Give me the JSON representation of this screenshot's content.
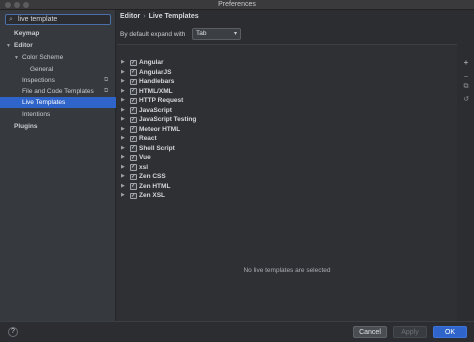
{
  "window": {
    "title": "Preferences"
  },
  "sidebar": {
    "search_value": "live template",
    "items": [
      {
        "label": "Keymap"
      },
      {
        "label": "Editor"
      },
      {
        "label": "Color Scheme"
      },
      {
        "label": "General"
      },
      {
        "label": "Inspections"
      },
      {
        "label": "File and Code Templates"
      },
      {
        "label": "Live Templates"
      },
      {
        "label": "Intentions"
      },
      {
        "label": "Plugins"
      }
    ]
  },
  "main": {
    "breadcrumb": {
      "parent": "Editor",
      "separator": "›",
      "current": "Live Templates"
    },
    "expand_label": "By default expand with",
    "expand_value": "Tab",
    "templates": [
      {
        "name": "Angular",
        "checked": true
      },
      {
        "name": "AngularJS",
        "checked": true
      },
      {
        "name": "Handlebars",
        "checked": true
      },
      {
        "name": "HTML/XML",
        "checked": true
      },
      {
        "name": "HTTP Request",
        "checked": true
      },
      {
        "name": "JavaScript",
        "checked": true
      },
      {
        "name": "JavaScript Testing",
        "checked": true
      },
      {
        "name": "Meteor HTML",
        "checked": true
      },
      {
        "name": "React",
        "checked": true
      },
      {
        "name": "Shell Script",
        "checked": true
      },
      {
        "name": "Vue",
        "checked": true
      },
      {
        "name": "xsl",
        "checked": true
      },
      {
        "name": "Zen CSS",
        "checked": true
      },
      {
        "name": "Zen HTML",
        "checked": true
      },
      {
        "name": "Zen XSL",
        "checked": true
      }
    ],
    "empty_message": "No live templates are selected"
  },
  "footer": {
    "help": "?",
    "cancel": "Cancel",
    "apply": "Apply",
    "ok": "OK"
  },
  "colors": {
    "accent": "#2f65ca",
    "background": "#2b2d30",
    "sidebar": "#36393d"
  }
}
